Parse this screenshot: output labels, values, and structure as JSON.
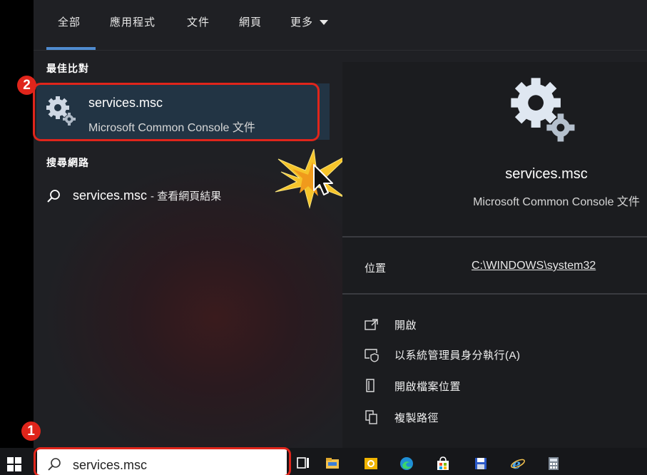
{
  "tabs": [
    "全部",
    "應用程式",
    "文件",
    "網頁",
    "更多"
  ],
  "sections": {
    "best_match": "最佳比對",
    "search_web": "搜尋網路"
  },
  "best_match": {
    "title": "services.msc",
    "subtitle": "Microsoft Common Console 文件",
    "icon": "gears-icon"
  },
  "web_result": {
    "query": "services.msc",
    "suffix": "- 查看網頁結果",
    "icon": "search-icon"
  },
  "details": {
    "title": "services.msc",
    "subtitle": "Microsoft Common Console 文件",
    "location_label": "位置",
    "location_path": "C:\\WINDOWS\\system32",
    "actions": [
      {
        "label": "開啟",
        "icon": "open-icon"
      },
      {
        "label": "以系統管理員身分執行(A)",
        "icon": "shield-icon"
      },
      {
        "label": "開啟檔案位置",
        "icon": "folder-location-icon"
      },
      {
        "label": "複製路徑",
        "icon": "copy-icon"
      }
    ]
  },
  "taskbar": {
    "search_value": "services.msc",
    "apps": [
      "task-view-icon",
      "file-explorer-icon",
      "outlook-icon",
      "edge-icon",
      "store-icon",
      "save-icon",
      "internet-explorer-icon",
      "calculator-icon"
    ]
  },
  "annotations": {
    "step1": "1",
    "step2": "2"
  },
  "colors": {
    "accent": "#4f8bd0",
    "highlight": "#e0251b",
    "selection": "#223444"
  }
}
